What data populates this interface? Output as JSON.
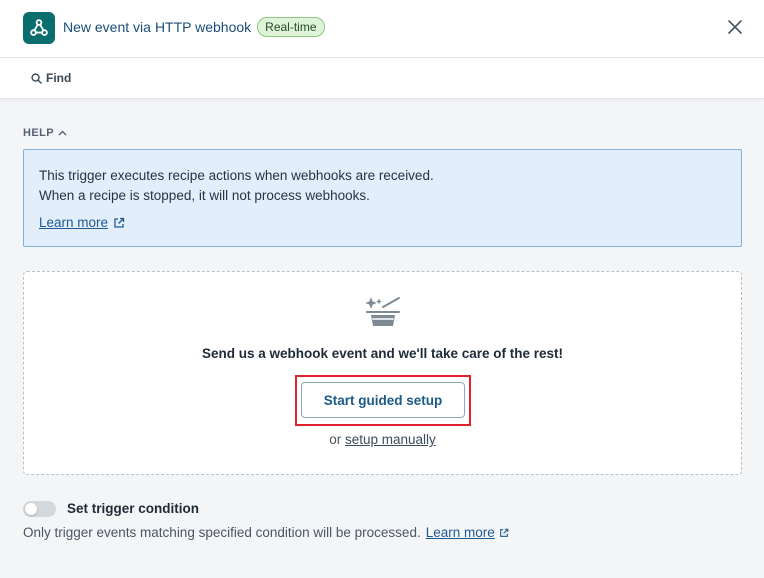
{
  "header": {
    "title_prefix": "New event via ",
    "app_name": "HTTP webhook",
    "badge": "Real-time",
    "icons": {
      "app": "webhook-icon",
      "close": "close-icon"
    }
  },
  "find": {
    "label": "Find",
    "icon": "search-icon"
  },
  "help": {
    "toggle_label": "HELP",
    "line1": "This trigger executes recipe actions when webhooks are received.",
    "line2": "When a recipe is stopped, it will not process webhooks.",
    "link": "Learn more"
  },
  "setup": {
    "icon": "magic-hat-icon",
    "headline": "Send us a webhook event and we'll take care of the rest!",
    "guided_button": "Start guided setup",
    "or_text": "or ",
    "manual_link": "setup manually"
  },
  "trigger_condition": {
    "label": "Set trigger condition",
    "enabled": false,
    "description": "Only trigger events matching specified condition will be processed.",
    "link": "Learn more"
  },
  "colors": {
    "brand": "#0b6e6e",
    "link": "#1e5a94",
    "highlight": "#e0232e",
    "help_bg": "#e2effa"
  }
}
